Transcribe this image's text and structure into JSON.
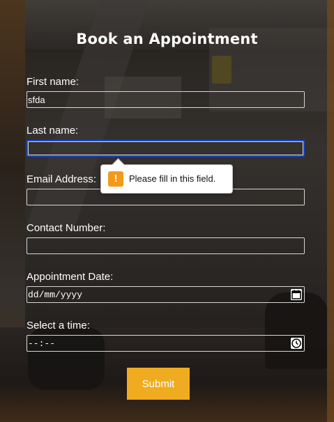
{
  "form": {
    "title": "Book an Appointment",
    "first_name": {
      "label": "First name:",
      "value": "sfda"
    },
    "last_name": {
      "label": "Last name:",
      "value": ""
    },
    "email": {
      "label": "Email Address:",
      "value": ""
    },
    "contact": {
      "label": "Contact Number:",
      "value": ""
    },
    "date": {
      "label": "Appointment Date:",
      "value": "dd/mm/yyyy"
    },
    "time": {
      "label": "Select a time:",
      "value": "--:--"
    },
    "submit_label": "Submit"
  },
  "validation": {
    "message": "Please fill in this field.",
    "icon": "warning-icon",
    "icon_glyph": "!",
    "color": "#f39a1b"
  },
  "colors": {
    "accent": "#f0ac20",
    "focus": "#1a4bd6"
  },
  "icons": {
    "date_picker": "calendar-icon",
    "time_picker": "clock-icon"
  }
}
